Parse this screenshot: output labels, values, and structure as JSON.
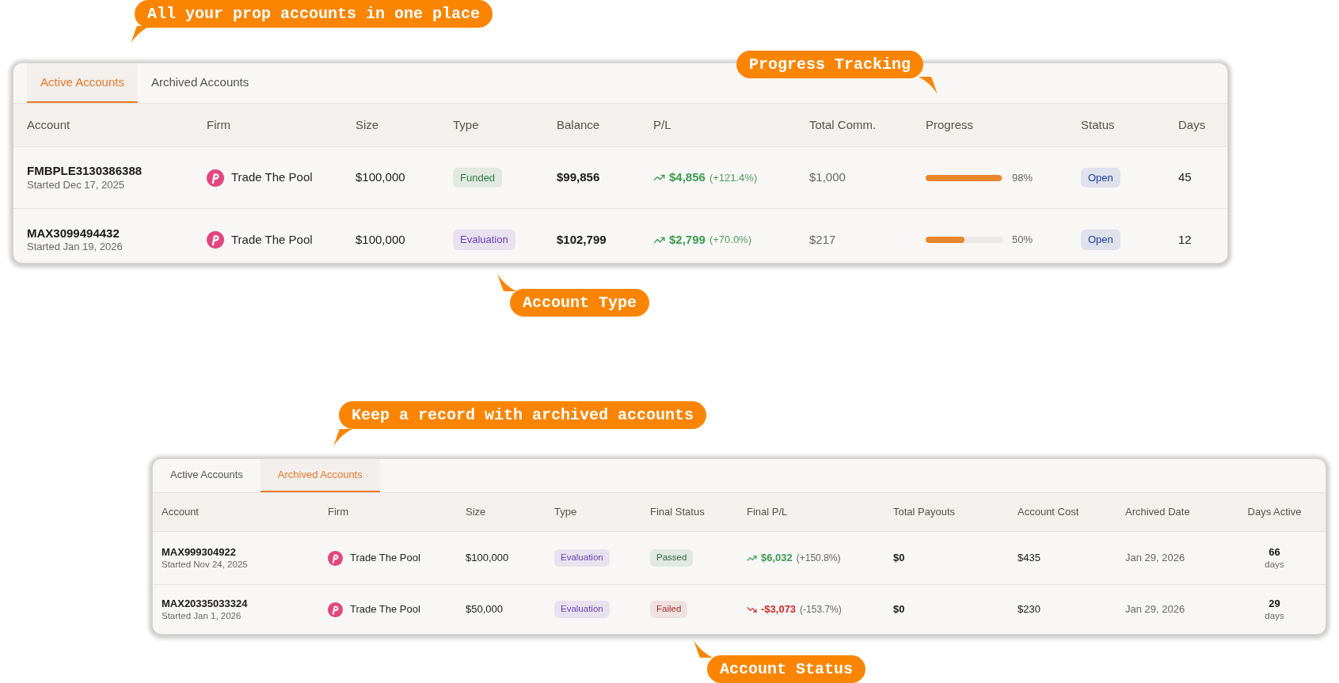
{
  "callouts": [
    {
      "text": "All your prop accounts in one place"
    },
    {
      "text": "Progress Tracking"
    },
    {
      "text": "Account Type"
    },
    {
      "text": "Keep a record with archived accounts"
    },
    {
      "text": "Account Status"
    }
  ],
  "panels": [
    {
      "tabs": [
        {
          "label": "Active Accounts",
          "selected": true
        },
        {
          "label": "Archived Accounts",
          "selected": false
        }
      ],
      "columns": [
        "Account",
        "Firm",
        "Size",
        "Type",
        "Balance",
        "P/L",
        "Total Comm.",
        "Progress",
        "Status",
        "Days"
      ],
      "rows": [
        {
          "cells": [
            {
              "kind": "account",
              "id": "FMBPLE3130386388",
              "started": "Started Dec 17, 2025"
            },
            {
              "kind": "firm",
              "name": "Trade The Pool"
            },
            {
              "kind": "text",
              "text": "$100,000"
            },
            {
              "kind": "badge",
              "text": "Funded",
              "color": "#2e7d43"
            },
            {
              "kind": "strong",
              "text": "$99,856"
            },
            {
              "kind": "pl",
              "negative": false,
              "amount": "$4,856",
              "percent": "(+121.4%)"
            },
            {
              "kind": "muted",
              "text": "$1,000"
            },
            {
              "kind": "progress",
              "level": 0.98,
              "reading": "98%"
            },
            {
              "kind": "badge",
              "text": "Open",
              "color": "#1e3f9a"
            },
            {
              "kind": "text",
              "text": "45"
            }
          ]
        },
        {
          "cells": [
            {
              "kind": "account",
              "id": "MAX3099494432",
              "started": "Started Jan 19, 2026"
            },
            {
              "kind": "firm",
              "name": "Trade The Pool"
            },
            {
              "kind": "text",
              "text": "$100,000"
            },
            {
              "kind": "badge",
              "text": "Evaluation",
              "color": "#6b3fb3"
            },
            {
              "kind": "strong",
              "text": "$102,799"
            },
            {
              "kind": "pl",
              "negative": false,
              "amount": "$2,799",
              "percent": "(+70.0%)"
            },
            {
              "kind": "muted",
              "text": "$217"
            },
            {
              "kind": "progress",
              "level": 0.5,
              "reading": "50%"
            },
            {
              "kind": "badge",
              "text": "Open",
              "color": "#1e3f9a"
            },
            {
              "kind": "text",
              "text": "12"
            }
          ]
        }
      ]
    },
    {
      "tabs": [
        {
          "label": "Active Accounts",
          "selected": false
        },
        {
          "label": "Archived Accounts",
          "selected": true
        }
      ],
      "columns": [
        "Account",
        "Firm",
        "Size",
        "Type",
        "Final Status",
        "Final P/L",
        "Total Payouts",
        "Account Cost",
        "Archived Date",
        "Days Active"
      ],
      "rows": [
        {
          "cells": [
            {
              "kind": "account",
              "id": "MAX999304922",
              "started": "Started Nov 24, 2025"
            },
            {
              "kind": "firm",
              "name": "Trade The Pool"
            },
            {
              "kind": "text",
              "text": "$100,000"
            },
            {
              "kind": "badge",
              "text": "Evaluation",
              "color": "#6b3fb3"
            },
            {
              "kind": "badge",
              "text": "Passed",
              "color": "#2e6b3e"
            },
            {
              "kind": "pl",
              "negative": false,
              "amount": "$6,032",
              "percent": "(+150.8%)"
            },
            {
              "kind": "strong",
              "text": "$0"
            },
            {
              "kind": "text",
              "text": "$435"
            },
            {
              "kind": "muted",
              "text": "Jan 29, 2026"
            },
            {
              "kind": "days",
              "value": "66",
              "unit": "days"
            }
          ]
        },
        {
          "cells": [
            {
              "kind": "account",
              "id": "MAX20335033324",
              "started": "Started Jan 1, 2026"
            },
            {
              "kind": "firm",
              "name": "Trade The Pool"
            },
            {
              "kind": "text",
              "text": "$50,000"
            },
            {
              "kind": "badge",
              "text": "Evaluation",
              "color": "#6b3fb3"
            },
            {
              "kind": "badge",
              "text": "Failed",
              "color": "#a3332b"
            },
            {
              "kind": "pl",
              "negative": true,
              "amount": "-$3,073",
              "percent": "(-153.7%)"
            },
            {
              "kind": "strong",
              "text": "$0"
            },
            {
              "kind": "text",
              "text": "$230"
            },
            {
              "kind": "muted",
              "text": "Jan 29, 2026"
            },
            {
              "kind": "days",
              "value": "29",
              "unit": "days"
            }
          ]
        }
      ]
    }
  ]
}
